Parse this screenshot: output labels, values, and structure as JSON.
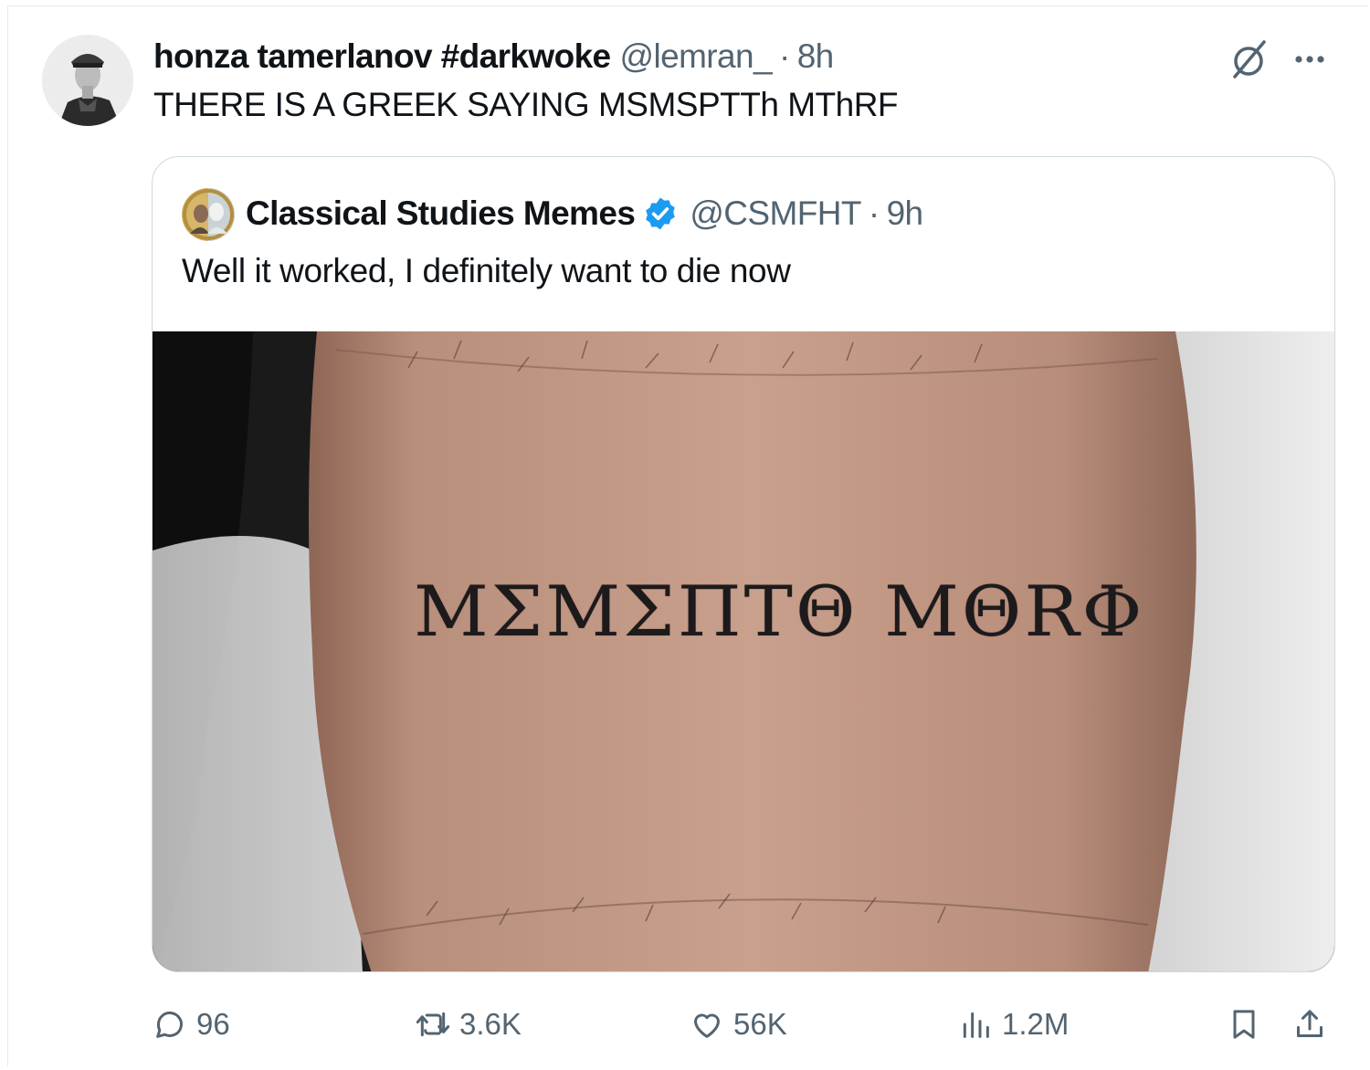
{
  "post": {
    "author_name": "honza tamerlanov #darkwoke",
    "author_handle": "@lemran_",
    "separator": "·",
    "time": "8h",
    "text": "THERE IS A GREEK SAYING MSMSPTTh MThRF",
    "avatar_icon": "soldier-portrait-avatar"
  },
  "quoted": {
    "author_name": "Classical Studies Memes",
    "verified": true,
    "author_handle": "@CSMFHT",
    "separator": "·",
    "time": "9h",
    "text": "Well it worked, I definitely want to die now",
    "avatar_icon": "classical-bust-avatar",
    "image": {
      "tattoo_text": "ΜΣΜΣΠΤΘ ΜΘRΦ"
    }
  },
  "actions": {
    "replies": "96",
    "reposts": "3.6K",
    "likes": "56K",
    "views": "1.2M"
  },
  "icons": {
    "top": [
      "grok-icon",
      "more-icon"
    ],
    "bottom": [
      "reply-icon",
      "retweet-icon",
      "like-icon",
      "views-icon",
      "bookmark-icon",
      "share-icon"
    ]
  },
  "colors": {
    "text_primary": "#0f1419",
    "text_secondary": "#536471",
    "border": "#cfd9de",
    "verified_blue": "#1d9bf0"
  }
}
